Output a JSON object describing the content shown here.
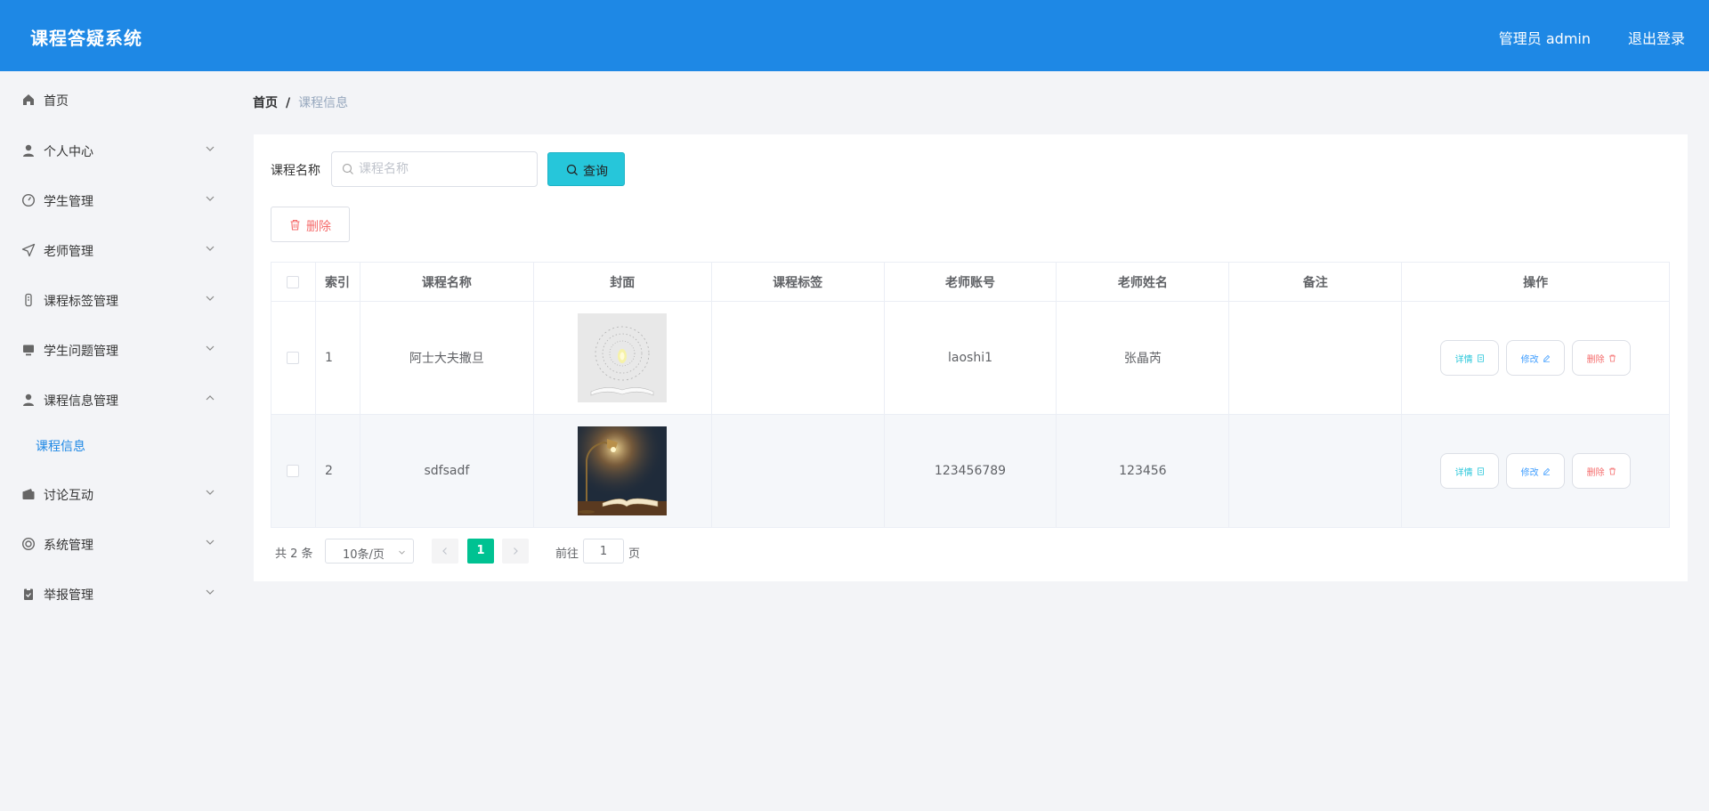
{
  "header": {
    "title": "课程答疑系统",
    "user": "管理员 admin",
    "logout": "退出登录"
  },
  "sidebar": {
    "items": [
      {
        "label": "首页",
        "icon": "home-icon"
      },
      {
        "label": "个人中心",
        "icon": "user-icon"
      },
      {
        "label": "学生管理",
        "icon": "gauge-icon"
      },
      {
        "label": "老师管理",
        "icon": "send-icon"
      },
      {
        "label": "课程标签管理",
        "icon": "tag-icon"
      },
      {
        "label": "学生问题管理",
        "icon": "monitor-icon"
      },
      {
        "label": "课程信息管理",
        "icon": "user-icon"
      },
      {
        "label": "讨论互动",
        "icon": "wallet-icon"
      },
      {
        "label": "系统管理",
        "icon": "settings-icon"
      },
      {
        "label": "举报管理",
        "icon": "clipboard-icon"
      }
    ],
    "active_sub": "课程信息"
  },
  "breadcrumb": {
    "home": "首页",
    "sep": "/",
    "current": "课程信息"
  },
  "search": {
    "label": "课程名称",
    "placeholder": "课程名称",
    "value": "",
    "button": "查询"
  },
  "toolbar": {
    "delete_label": "删除"
  },
  "table": {
    "columns": [
      "索引",
      "课程名称",
      "封面",
      "课程标签",
      "老师账号",
      "老师姓名",
      "备注",
      "操作"
    ],
    "rows": [
      {
        "index": "1",
        "name": "阿士大夫撒旦",
        "tag": "",
        "account": "laoshi1",
        "teacher": "张晶芮",
        "note": ""
      },
      {
        "index": "2",
        "name": "sdfsadf",
        "tag": "",
        "account": "123456789",
        "teacher": "123456",
        "note": ""
      }
    ],
    "actions": {
      "detail": "详情",
      "edit": "修改",
      "delete": "删除"
    }
  },
  "pagination": {
    "total": "共 2 条",
    "page_size": "10条/页",
    "current_page": "1",
    "goto_label": "前往",
    "goto_value": "1",
    "page_suffix": "页"
  },
  "colors": {
    "header": "#1e88e5",
    "query_button": "#26c6da",
    "pager_active": "#00c292",
    "danger": "#f56c6c"
  }
}
